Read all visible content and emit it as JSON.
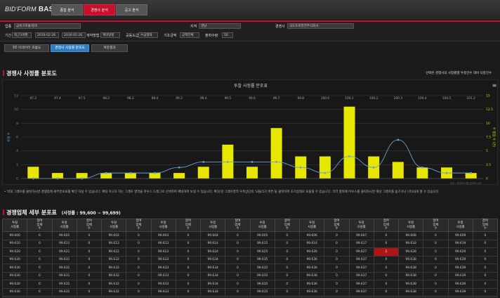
{
  "app": {
    "logo_main": "BID'FORM",
    "logo_sub": "BAS"
  },
  "nav": {
    "tabs": [
      {
        "label": "종합 분석",
        "active": false
      },
      {
        "label": "경쟁사 분석",
        "active": true
      },
      {
        "label": "공고 분석",
        "active": false
      }
    ]
  },
  "filters": {
    "upjong_label": "업종",
    "upjong_value": "금속구조물/창호",
    "region_label": "지역",
    "region_value": "경남",
    "competitor_label": "경쟁사",
    "competitor_value": "극도토로한전주식회사",
    "period_label": "기간",
    "period_select": "최근3개월",
    "date_from": "2016-02-26",
    "date_to": "2016-05-26",
    "contract_label": "계약방법",
    "contract_value": "계약방법",
    "grade_label": "공동도급",
    "grade_value": "수급형태",
    "price_label": "기초금액",
    "price_value": "금액전체",
    "count_label": "출력수량",
    "count_value": "50"
  },
  "subtabs": [
    {
      "label": "3D 이데이터 흐름도",
      "active": false
    },
    {
      "label": "경쟁사 사정률 분포도",
      "active": true
    },
    {
      "label": "계운결과",
      "active": false
    }
  ],
  "section1": {
    "title": "경쟁사 사정률 분포도",
    "right_note": "선택된 경쟁사의 사정률별 투찰건수 대비 낙찰건수"
  },
  "chart_data": {
    "type": "bar",
    "title": "투찰 사정률 분포표",
    "categories": [
      "97.2",
      "97.4",
      "97.5",
      "98.2",
      "98.3",
      "98.4",
      "99.2",
      "99.4",
      "99.5",
      "99.6",
      "99.7",
      "99.8",
      "100.0",
      "100.1",
      "100.2",
      "100.3",
      "100.4",
      "100.5",
      "101.2"
    ],
    "series": [
      {
        "name": "투찰 수",
        "kind": "bar",
        "values": [
          1.7,
          0.8,
          0.8,
          0.8,
          0.8,
          0.8,
          0.8,
          1.7,
          4.9,
          1.7,
          7.3,
          3.2,
          3.2,
          10.4,
          3.2,
          2.4,
          1.6,
          1.6,
          0.8
        ]
      },
      {
        "name": "낙찰 수",
        "kind": "line",
        "values": [
          0,
          0,
          0,
          1,
          1,
          1,
          2,
          3,
          3,
          3,
          3,
          2,
          1,
          4,
          2,
          7,
          2,
          1,
          1
        ]
      }
    ],
    "ylim_left": [
      0,
      12
    ],
    "yticks_left": [
      0,
      2,
      4,
      6,
      8,
      10,
      12
    ],
    "ylim_right": [
      0,
      15
    ],
    "yticks_right": [
      0,
      2.5,
      5,
      7.5,
      10,
      12.5,
      15
    ],
    "ylabel_left": "투찰 수",
    "ylabel_right": "수 잘점 수 (건)",
    "colors": {
      "bar": "#e6e600",
      "line": "#6a9fd4"
    },
    "grid": true,
    "credit": "세공 : 한국비드폼 네이버 비즈"
  },
  "chart_note": "• 막대 그래프를 클릭하시면 경쟁업체 세부분포표를 확인 하실 수 있습니다. 확대 하고자 하는 그래프 영역을 마우스 드래그로 선택하여 확대하여 보실 수 있습니다. 확대 된 그래프영역 우측상단의 '되돌리기 버튼'을 클릭하여 초기상태로 되돌릴 수 있습니다. 각각 항목에 마우스를 클릭하시면 해당 그래프를 숨기거나 나타내게 할 수 있습니다.",
  "section2": {
    "title": "경쟁업체 세부 분포표",
    "range": "(사정률 : 99,600 ~ 99,699)"
  },
  "table": {
    "headers": [
      "투찰 사정률",
      "참여 업체 수"
    ],
    "groups": 10,
    "rates": [
      [
        "99.600",
        "99.601",
        "99.602",
        "99.603",
        "99.604",
        "99.605",
        "99.606",
        "99.607",
        "99.608",
        "99.609"
      ],
      [
        "99.610",
        "99.611",
        "99.612",
        "99.613",
        "99.614",
        "99.615",
        "99.616",
        "99.617",
        "99.618",
        "99.619"
      ],
      [
        "99.620",
        "99.621",
        "99.622",
        "99.623",
        "99.624",
        "99.625",
        "99.626",
        "99.627",
        "99.628",
        "99.629"
      ],
      [
        "99.630",
        "99.631",
        "99.632",
        "99.633",
        "99.634",
        "99.635",
        "99.636",
        "99.637",
        "99.638",
        "99.639"
      ],
      [
        "99.630",
        "99.631",
        "99.632",
        "99.633",
        "99.634",
        "99.635",
        "99.636",
        "99.637",
        "99.638",
        "99.639"
      ],
      [
        "99.630",
        "99.631",
        "99.632",
        "99.633",
        "99.634",
        "99.635",
        "99.636",
        "99.637",
        "99.638",
        "99.639"
      ],
      [
        "99.630",
        "99.631",
        "99.632",
        "99.633",
        "99.634",
        "99.635",
        "99.636",
        "99.637",
        "99.638",
        "99.639"
      ],
      [
        "99.630",
        "99.631",
        "99.632",
        "99.633",
        "99.634",
        "99.635",
        "99.636",
        "99.637",
        "99.638",
        "99.639"
      ]
    ],
    "counts_default": "0",
    "highlight": {
      "row": 2,
      "group": 7,
      "value": "1"
    }
  }
}
